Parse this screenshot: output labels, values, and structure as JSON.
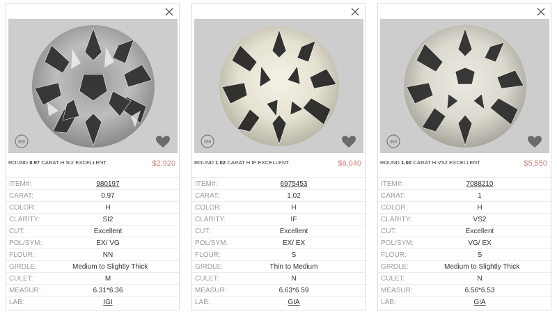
{
  "labels": {
    "item": "ITEM#:",
    "carat": "CARAT:",
    "color": "COLOR:",
    "clarity": "CLARITY:",
    "cut": "CUT:",
    "polsym": "POL/SYM:",
    "flour": "FLOUR:",
    "girdle": "GIRDLE:",
    "culet": "CULET:",
    "measur": "MEASUR:",
    "lab": "LAB:"
  },
  "icons": {
    "close": "close-icon",
    "rotate": "360-view-icon",
    "favorite": "heart-icon"
  },
  "colors": {
    "price": "#c9847c",
    "label": "#9a9a9a"
  },
  "cards": [
    {
      "title_prefix": "ROUND ",
      "title_carat": "0.97",
      "title_suffix": " CARAT H SI2 EXCELLENT",
      "price": "$2,920",
      "item": "980197",
      "carat": "0.97",
      "color": "H",
      "clarity": "SI2",
      "cut": "Excellent",
      "polsym": "EX/ VG",
      "flour": "NN",
      "girdle": "Medium to Slightly Thick",
      "culet": "M",
      "measur": "6.31*6.36",
      "lab": "IGI"
    },
    {
      "title_prefix": "ROUND ",
      "title_carat": "1.02",
      "title_suffix": " CARAT H IF EXCELLENT",
      "price": "$6,040",
      "item": "6975453",
      "carat": "1.02",
      "color": "H",
      "clarity": "IF",
      "cut": "Excellent",
      "polsym": "EX/ EX",
      "flour": "S",
      "girdle": "Thin to Medium",
      "culet": "N",
      "measur": "6.63*6.59",
      "lab": "GIA"
    },
    {
      "title_prefix": "ROUND ",
      "title_carat": "1.00",
      "title_suffix": " CARAT H VS2 EXCELLENT",
      "price": "$5,550",
      "item": "7088210",
      "carat": "1",
      "color": "H",
      "clarity": "VS2",
      "cut": "Excellent",
      "polsym": "VG/ EX",
      "flour": "S",
      "girdle": "Medium to Slightly Thick",
      "culet": "N",
      "measur": "6.56*6.53",
      "lab": "GIA"
    }
  ]
}
